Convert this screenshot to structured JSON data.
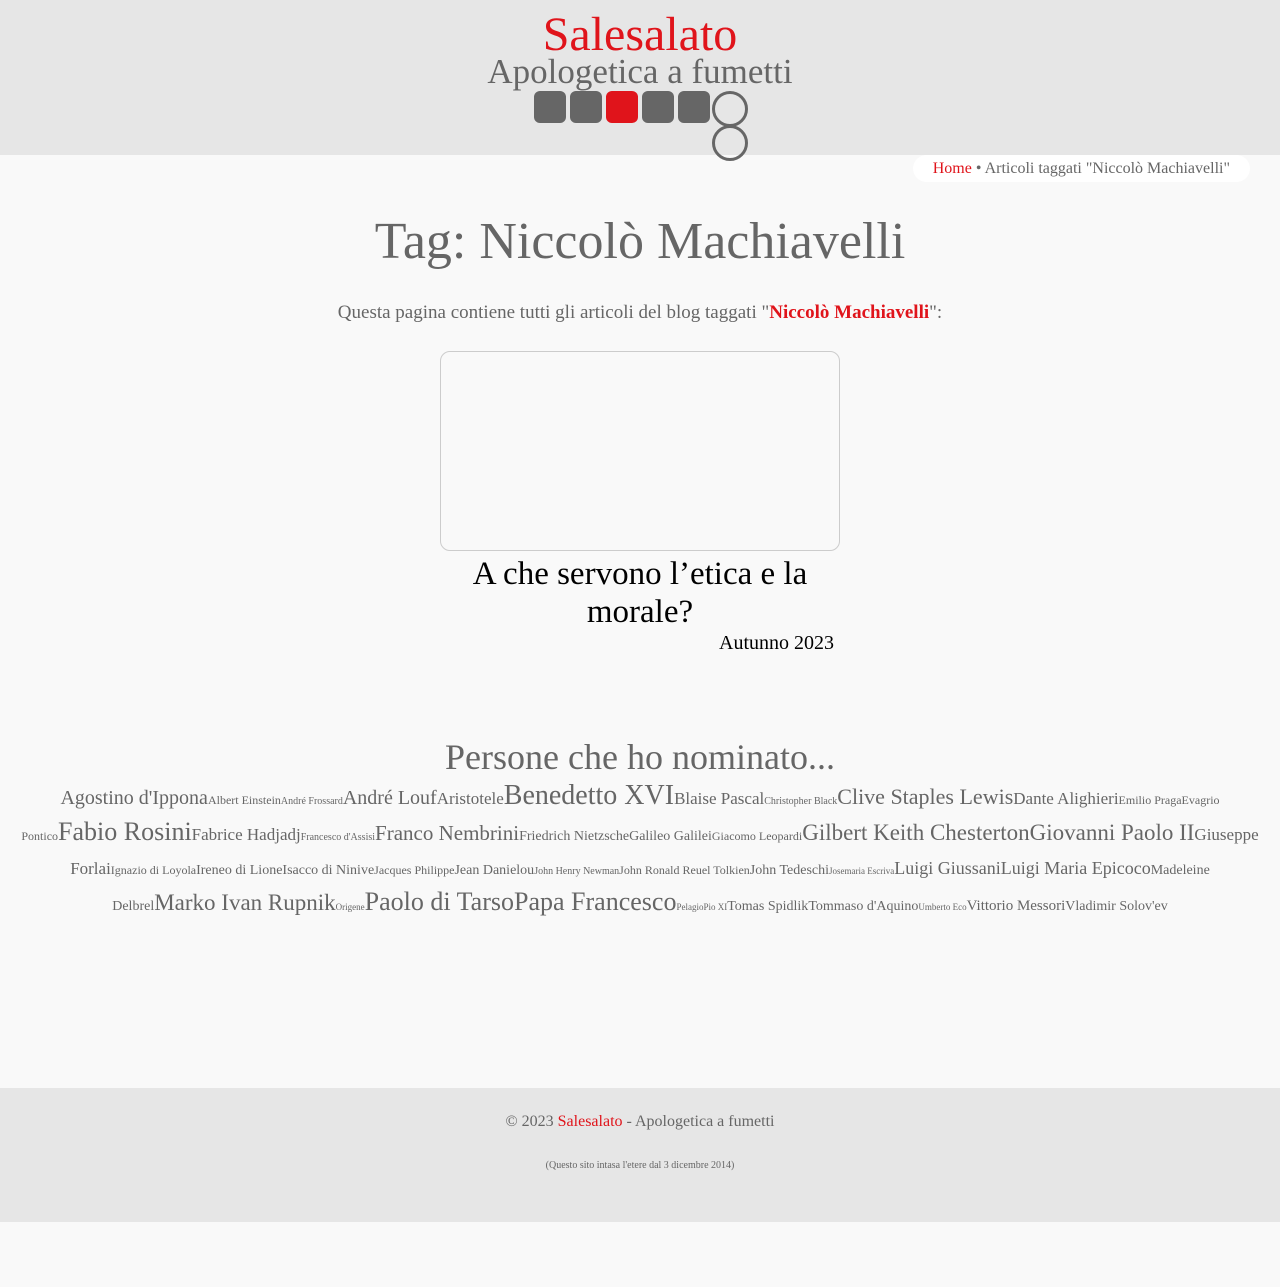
{
  "header": {
    "site_name": "Salesalato",
    "subtitle": "Apologetica a fumetti"
  },
  "breadcrumb": {
    "home": "Home",
    "separator": "•",
    "current": "Articoli taggati \"Niccolò Machiavelli\""
  },
  "main": {
    "title": "Tag: Niccolò Machiavelli",
    "intro_before": "Questa pagina contiene tutti gli articoli del blog taggati \"",
    "intro_tag": "Niccolò Machiavelli",
    "intro_after": "\":",
    "article": {
      "title": "A che servono l’etica e la morale?",
      "date": "Autunno 2023"
    }
  },
  "cloud": {
    "title": "Persone che ho nominato...",
    "tags": [
      {
        "label": "Agostino d'Ippona",
        "size": 20
      },
      {
        "label": "Albert Einstein",
        "size": 12
      },
      {
        "label": "André Frossard",
        "size": 10
      },
      {
        "label": "André Louf",
        "size": 20
      },
      {
        "label": "Aristotele",
        "size": 17
      },
      {
        "label": "Benedetto XVI",
        "size": 28
      },
      {
        "label": "Blaise Pascal",
        "size": 17
      },
      {
        "label": "Christopher Black",
        "size": 10
      },
      {
        "label": "Clive Staples Lewis",
        "size": 22
      },
      {
        "label": "Dante Alighieri",
        "size": 17
      },
      {
        "label": "Emilio Praga",
        "size": 12
      },
      {
        "label": "Evagrio Pontico",
        "size": 12
      },
      {
        "label": "Fabio Rosini",
        "size": 26
      },
      {
        "label": "Fabrice Hadjadj",
        "size": 17
      },
      {
        "label": "Francesco d'Assisi",
        "size": 10
      },
      {
        "label": "Franco Nembrini",
        "size": 21
      },
      {
        "label": "Friedrich Nietzsche",
        "size": 14
      },
      {
        "label": "Galileo Galilei",
        "size": 14
      },
      {
        "label": "Giacomo Leopardi",
        "size": 12
      },
      {
        "label": "Gilbert Keith Chesterton",
        "size": 23
      },
      {
        "label": "Giovanni Paolo II",
        "size": 23
      },
      {
        "label": "Giuseppe Forlai",
        "size": 17
      },
      {
        "label": "Ignazio di Loyola",
        "size": 12
      },
      {
        "label": "Ireneo di Lione",
        "size": 14
      },
      {
        "label": "Isacco di Ninive",
        "size": 14
      },
      {
        "label": "Jacques Philippe",
        "size": 12
      },
      {
        "label": "Jean Danielou",
        "size": 14
      },
      {
        "label": "John Henry Newman",
        "size": 10
      },
      {
        "label": "John Ronald Reuel Tolkien",
        "size": 12
      },
      {
        "label": "John Tedeschi",
        "size": 14
      },
      {
        "label": "Josemaria Escriva",
        "size": 9
      },
      {
        "label": "Luigi Giussani",
        "size": 18
      },
      {
        "label": "Luigi Maria Epicoco",
        "size": 18
      },
      {
        "label": "Madeleine Delbrel",
        "size": 14
      },
      {
        "label": "Marko Ivan Rupnik",
        "size": 23
      },
      {
        "label": "Origene",
        "size": 9
      },
      {
        "label": "Paolo di Tarso",
        "size": 26
      },
      {
        "label": "Papa Francesco",
        "size": 26
      },
      {
        "label": "Pelagio",
        "size": 9
      },
      {
        "label": "Pio XI",
        "size": 9
      },
      {
        "label": "Tomas Spidlik",
        "size": 14
      },
      {
        "label": "Tommaso d'Aquino",
        "size": 14
      },
      {
        "label": "Umberto Eco",
        "size": 9
      },
      {
        "label": "Vittorio Messori",
        "size": 15
      },
      {
        "label": "Vladimir Solov'ev",
        "size": 14
      }
    ]
  },
  "footer": {
    "copyright_prefix": "© 2023",
    "site_name": "Salesalato",
    "copyright_suffix": "- Apologetica a fumetti",
    "since": "(Questo sito intasa l'etere dal 3 dicembre 2014)"
  },
  "colors": {
    "accent": "#e0141b",
    "text": "#666666",
    "header_bg": "#e6e6e6",
    "page_bg": "#f9f9f9"
  }
}
